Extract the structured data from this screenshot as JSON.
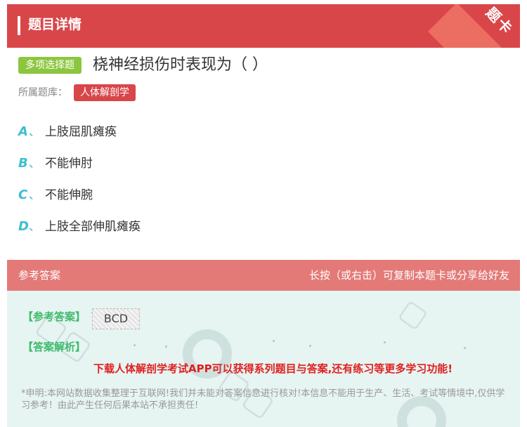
{
  "header": {
    "title": "题目详情",
    "corner_badge": "题卡"
  },
  "question": {
    "type_tag": "多项选择题",
    "title": "桡神经损伤时表现为（  ）",
    "bank_label": "所属题库：",
    "bank_name": "人体解剖学"
  },
  "options": [
    {
      "letter": "A",
      "sep": "、",
      "text": "上肢屈肌瘫痪"
    },
    {
      "letter": "B",
      "sep": "、",
      "text": "不能伸肘"
    },
    {
      "letter": "C",
      "sep": "、",
      "text": "不能伸腕"
    },
    {
      "letter": "D",
      "sep": "、",
      "text": "上肢全部伸肌瘫痪"
    }
  ],
  "answer": {
    "section_title": "参考答案",
    "share_hint": "长按（或右击）可复制本题卡或分享给好友",
    "ref_label": "【参考答案】",
    "ref_value": "BCD",
    "analysis_label": "【答案解析】",
    "promo": "下载人体解剖学考试APP可以获得系列题目与答案,还有练习等更多学习功能!",
    "notice": "*申明:本网站数据收集整理于互联网!我们并未能对答案信息进行核对!本信息不能用于生产、生活、考试等情境中,仅供学习参考！由此产生任何后果本站不承担责任!"
  },
  "colors": {
    "brand_red": "#d9464a",
    "accent_teal": "#3cbfcf",
    "tag_green": "#8cc63f",
    "answer_green": "#3dbb6c",
    "answer_bg": "#e6f4f2"
  }
}
